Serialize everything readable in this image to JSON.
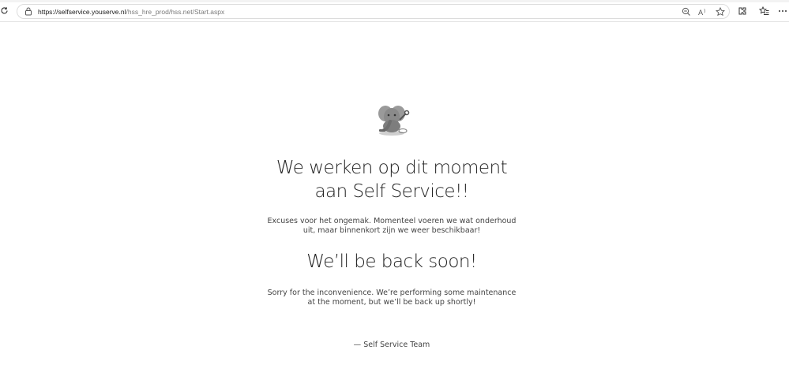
{
  "browser": {
    "url_host": "https://selfservice.youserve.nl",
    "url_path": "/hss_hre_prod/hss.net/Start.aspx",
    "icons": [
      "reload-icon",
      "lock-icon",
      "zoom-out-icon",
      "read-aloud-icon",
      "favorite-star-icon",
      "extensions-icon",
      "favorites-icon",
      "more-icon"
    ]
  },
  "page": {
    "logo_icon": "elephant-mechanic-icon",
    "heading_nl_line1": "We werken op dit moment",
    "heading_nl_line2": "aan Self Service!!",
    "body_nl_line1": "Excuses voor het ongemak. Momenteel voeren we wat onderhoud",
    "body_nl_line2": "uit, maar binnenkort zijn we weer beschikbaar!",
    "heading_en": "We’ll be back soon!",
    "body_en_line1": "Sorry for the inconvenience. We’re performing some maintenance",
    "body_en_line2": "at the moment, but we’ll be back up shortly!",
    "signature": "— Self Service Team"
  }
}
